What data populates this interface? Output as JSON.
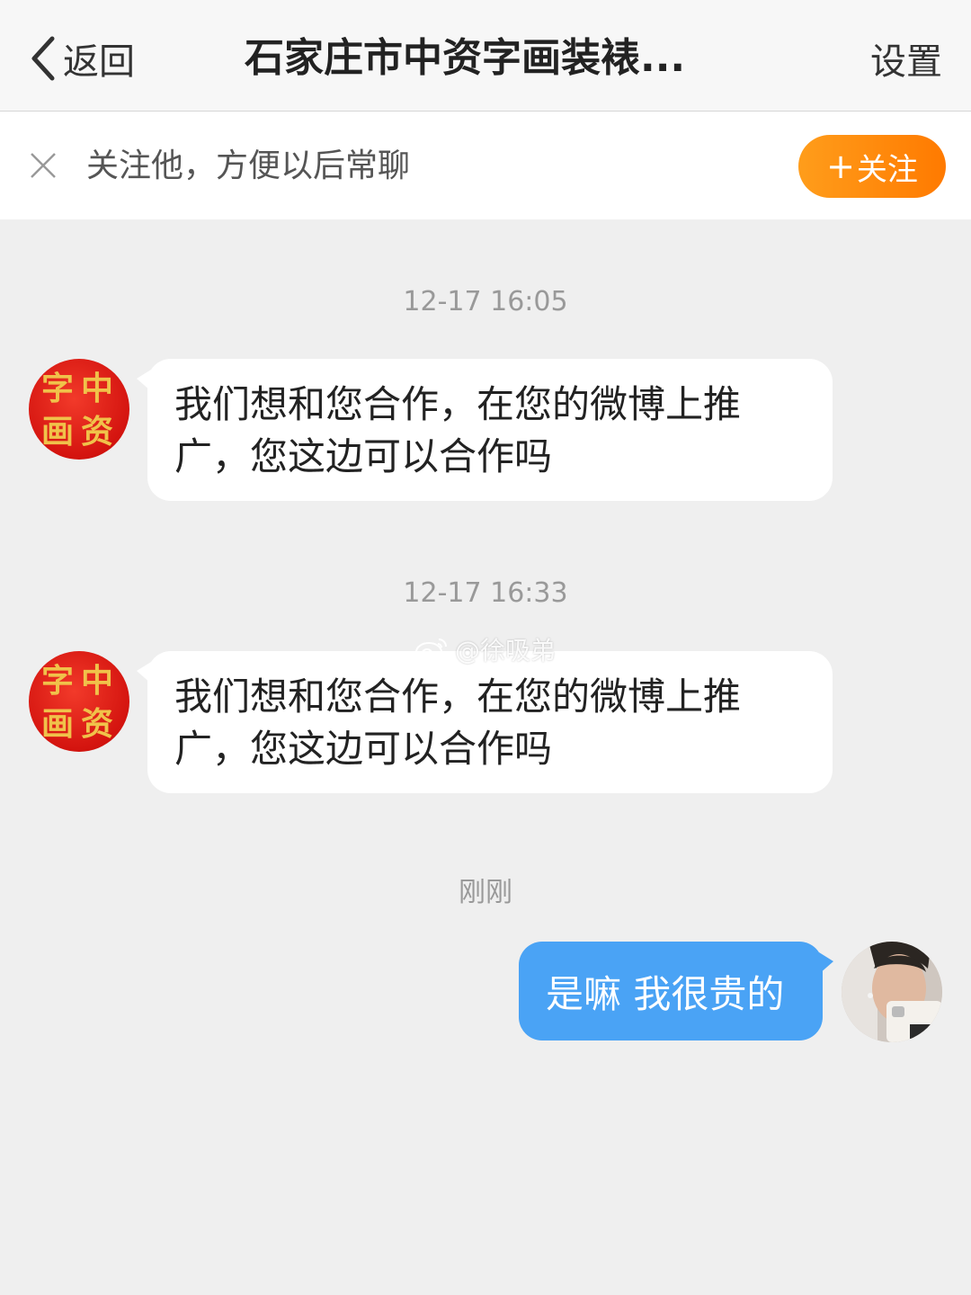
{
  "nav": {
    "back_label": "返回",
    "title": "石家庄市中资字画装裱...",
    "settings_label": "设置"
  },
  "follow_prompt": {
    "text": "关注他，方便以后常聊",
    "button_label": "关注",
    "button_plus": "+"
  },
  "messages": [
    {
      "timestamp": "12-17 16:05",
      "direction": "incoming",
      "line1": "我们想和您合作，在您的微博上推",
      "line2": "广，您这边可以合作吗"
    },
    {
      "timestamp": "12-17 16:33",
      "direction": "incoming",
      "line1": "我们想和您合作，在您的微博上推",
      "line2": "广，您这边可以合作吗"
    },
    {
      "timestamp": "刚刚",
      "direction": "outgoing",
      "text": "是嘛 我很贵的"
    }
  ],
  "sender_avatar_glyphs": [
    "中",
    "资",
    "字",
    "画"
  ],
  "watermark": "@徐吸弟",
  "colors": {
    "follow_button": "#ff8c0a",
    "outgoing_bubble": "#4aa3f5",
    "avatar_seal": "#d4140f",
    "background": "#efefef"
  }
}
